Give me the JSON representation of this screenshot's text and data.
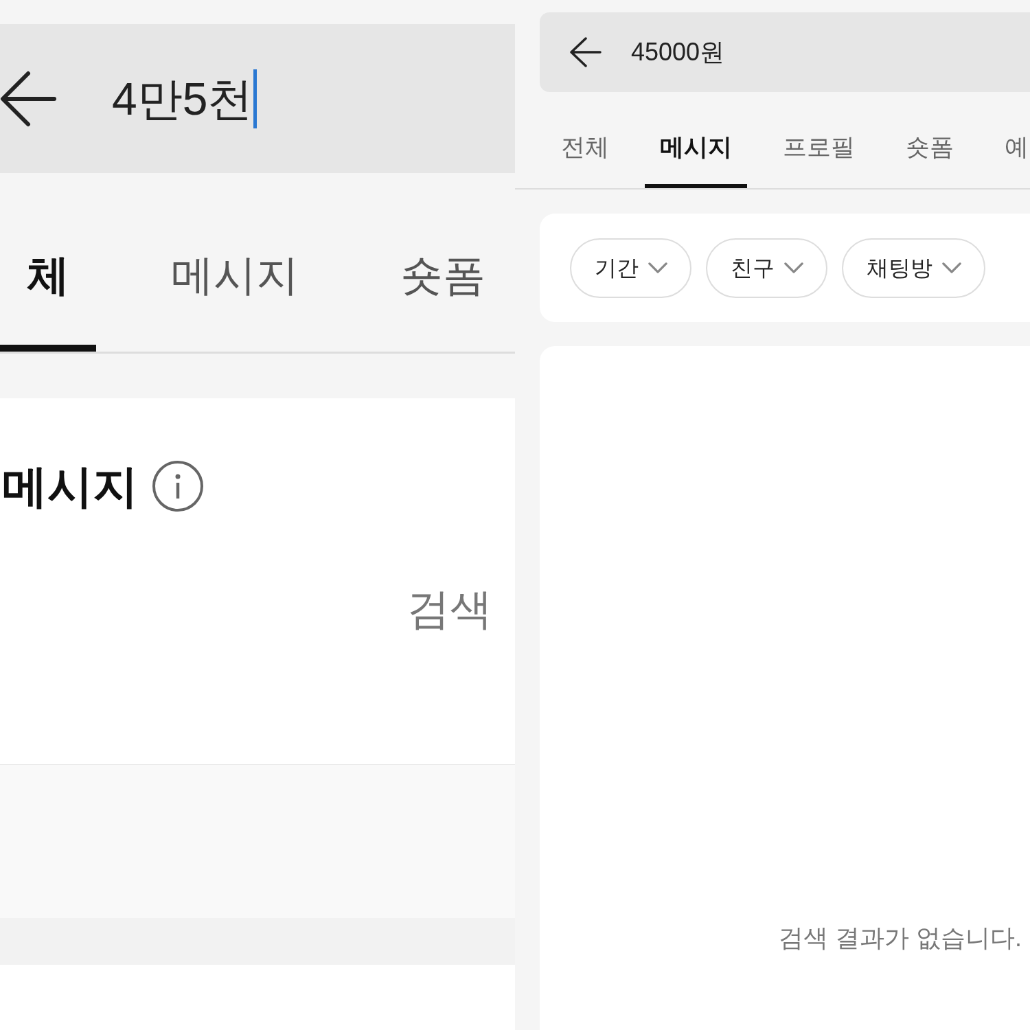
{
  "left_screen": {
    "search": {
      "value": "4만5천",
      "focused": true
    },
    "tabs": [
      {
        "label": "체",
        "selected": true
      },
      {
        "label": "메시지",
        "selected": false
      },
      {
        "label": "숏폼",
        "selected": false
      }
    ],
    "message_section": {
      "title": "메시지",
      "empty_text": "검색"
    }
  },
  "right_screen": {
    "search": {
      "value": "45000원",
      "focused": false
    },
    "tabs": [
      {
        "label": "전체",
        "selected": false
      },
      {
        "label": "메시지",
        "selected": true
      },
      {
        "label": "프로필",
        "selected": false
      },
      {
        "label": "숏폼",
        "selected": false
      },
      {
        "label": "예",
        "selected": false
      }
    ],
    "filters": [
      {
        "label": "기간"
      },
      {
        "label": "친구"
      },
      {
        "label": "채팅방"
      }
    ],
    "empty_text": "검색 결과가 없습니다."
  }
}
